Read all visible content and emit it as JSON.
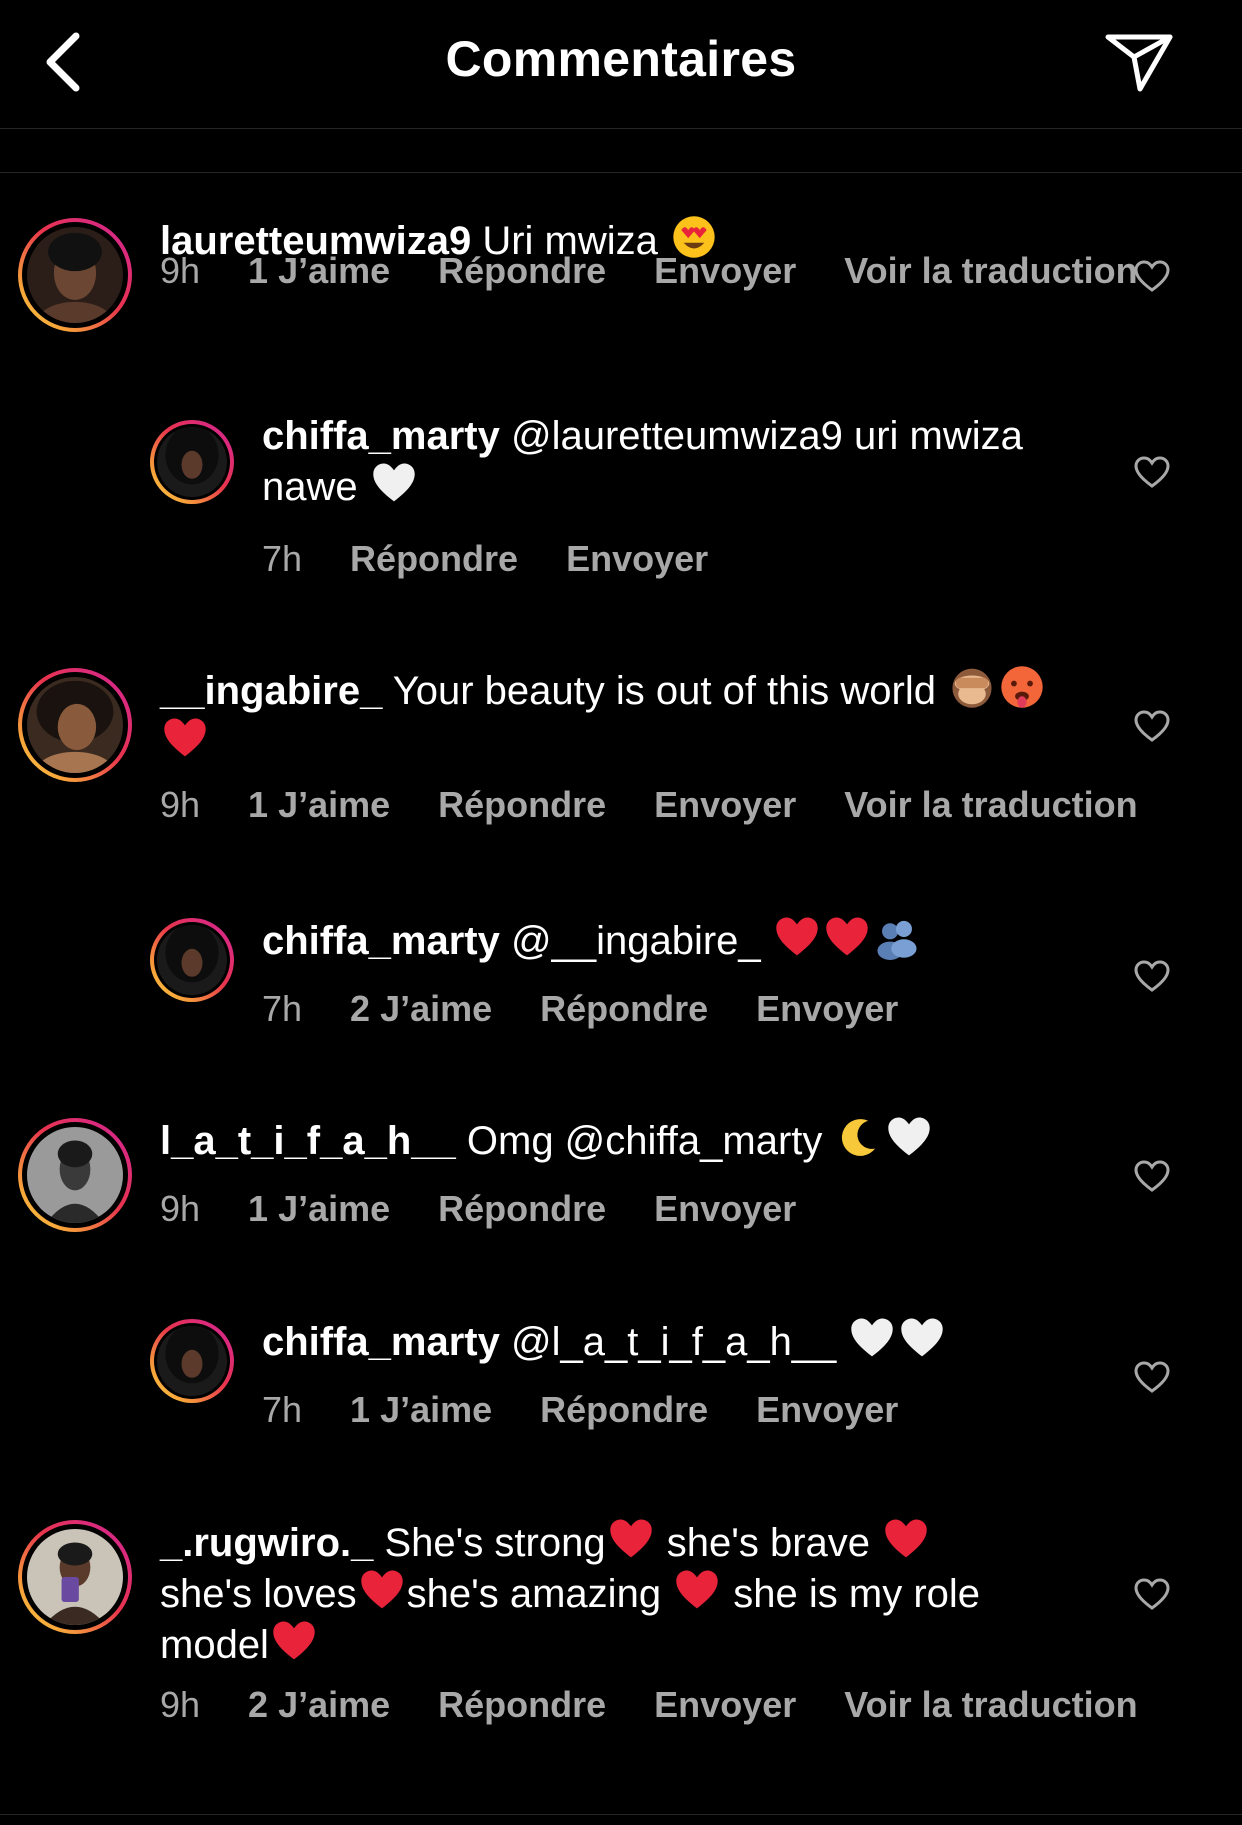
{
  "header": {
    "title": "Commentaires",
    "back_icon": "chevron-left-icon",
    "send_icon": "paper-plane-icon"
  },
  "labels": {
    "reply": "Répondre",
    "send": "Envoyer",
    "translate": "Voir la traduction"
  },
  "comments": [
    {
      "username": "lauretteumwiza9",
      "text": " Uri mwiza ",
      "emojis": [
        "heart-eyes-emoji"
      ],
      "time": "9h",
      "likes": "1 J’aime",
      "translate": true
    },
    {
      "username": "chiffa_marty",
      "text": " @lauretteumwiza9 uri mwiza nawe ",
      "emojis": [
        "white-heart-emoji"
      ],
      "time": "7h",
      "likes": "",
      "translate": false
    },
    {
      "username": "__ingabire_",
      "text": " Your beauty is out of this world ",
      "emojis": [
        "see-no-evil-monkey-emoji",
        "hot-face-emoji",
        "red-heart-emoji"
      ],
      "time": "9h",
      "likes": "1 J’aime",
      "translate": true
    },
    {
      "username": "chiffa_marty",
      "text": " @__ingabire_ ",
      "emojis": [
        "red-heart-emoji",
        "red-heart-emoji",
        "busts-in-silhouette-emoji"
      ],
      "time": "7h",
      "likes": "2 J’aime",
      "translate": false
    },
    {
      "username": "l_a_t_i_f_a_h__",
      "text": " Omg @chiffa_marty ",
      "emojis": [
        "crescent-moon-emoji",
        "white-heart-emoji"
      ],
      "time": "9h",
      "likes": "1 J’aime",
      "translate": false
    },
    {
      "username": "chiffa_marty",
      "text": " @l_a_t_i_f_a_h__ ",
      "emojis": [
        "white-heart-emoji",
        "white-heart-emoji"
      ],
      "time": "7h",
      "likes": "1 J’aime",
      "translate": false
    },
    {
      "username": "_.rugwiro._",
      "text_parts": [
        " She's strong",
        " she's brave ",
        "she's loves",
        "she's amazing ",
        " she is my role model"
      ],
      "emojis": [
        "red-heart-emoji",
        "red-heart-emoji",
        "red-heart-emoji",
        "red-heart-emoji",
        "red-heart-emoji"
      ],
      "time": "9h",
      "likes": "2 J’aime",
      "translate": true
    }
  ]
}
